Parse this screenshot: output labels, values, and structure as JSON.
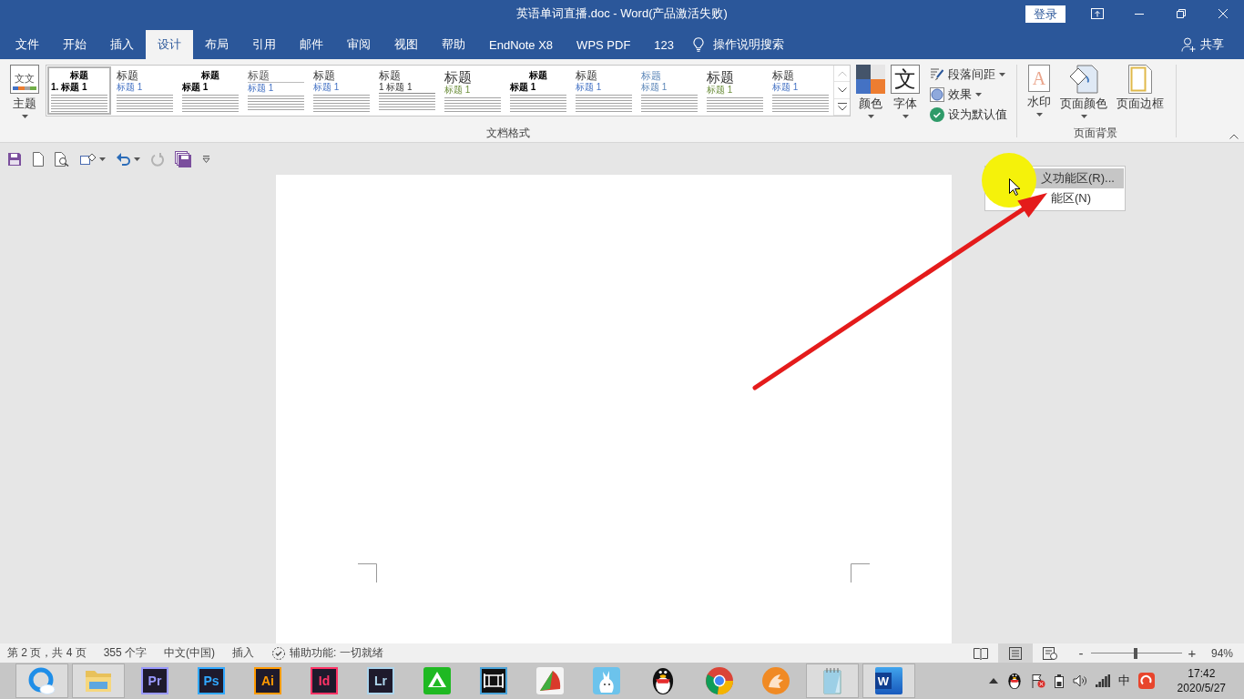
{
  "window": {
    "title": "英语单词直播.doc - Word(产品激活失败)",
    "sign_in": "登录"
  },
  "tabs": [
    {
      "label": "文件",
      "selected": false
    },
    {
      "label": "开始",
      "selected": false
    },
    {
      "label": "插入",
      "selected": false
    },
    {
      "label": "设计",
      "selected": true
    },
    {
      "label": "布局",
      "selected": false
    },
    {
      "label": "引用",
      "selected": false
    },
    {
      "label": "邮件",
      "selected": false
    },
    {
      "label": "审阅",
      "selected": false
    },
    {
      "label": "视图",
      "selected": false
    },
    {
      "label": "帮助",
      "selected": false
    },
    {
      "label": "EndNote X8",
      "selected": false
    },
    {
      "label": "WPS PDF",
      "selected": false
    },
    {
      "label": "123",
      "selected": false
    }
  ],
  "tell_me": {
    "label": "操作说明搜索"
  },
  "share": {
    "label": "共享"
  },
  "ribbon": {
    "document_formatting": {
      "label": "文档格式",
      "theme_button": {
        "label": "主题",
        "icon_text": "文文",
        "has_menu": true
      },
      "style_gallery": [
        {
          "kind": "centered",
          "heading": "标题",
          "subheading": "1. 标题 1",
          "selected": true
        },
        {
          "kind": "plain",
          "heading": "标题",
          "subheading": "标题 1",
          "selected": false
        },
        {
          "kind": "centered",
          "heading": "标题",
          "subheading": "标题 1",
          "selected": false
        },
        {
          "kind": "underlined",
          "heading": "标题",
          "subheading": "标题 1",
          "selected": false
        },
        {
          "kind": "plain",
          "heading": "标题",
          "subheading": "标题 1",
          "selected": false
        },
        {
          "kind": "ruled",
          "heading": "标题",
          "subheading": "1 标题 1",
          "selected": false
        },
        {
          "kind": "large",
          "heading": "标题",
          "subheading": "标题 1",
          "selected": false
        },
        {
          "kind": "centered",
          "heading": "标题",
          "subheading": "标题 1",
          "selected": false
        },
        {
          "kind": "plain",
          "heading": "标题",
          "subheading": "标题 1",
          "selected": false
        },
        {
          "kind": "accent",
          "heading": "标题",
          "subheading": "标题 1",
          "selected": false
        },
        {
          "kind": "large",
          "heading": "标题",
          "subheading": "标题 1",
          "selected": false
        },
        {
          "kind": "plain",
          "heading": "标题",
          "subheading": "标题 1",
          "selected": false
        }
      ],
      "gallery_scroll": [
        {
          "kind": "up",
          "disabled": true
        },
        {
          "kind": "down",
          "disabled": false
        },
        {
          "kind": "more",
          "disabled": false
        }
      ],
      "colors_button": {
        "label": "颜色",
        "has_menu": true
      },
      "fonts_button": {
        "label": "字体",
        "icon_text": "文",
        "has_menu": true
      },
      "small_buttons": [
        {
          "kind": "paragraph-spacing",
          "label": "段落间距",
          "has_menu": true
        },
        {
          "kind": "effects",
          "label": "效果",
          "has_menu": true
        },
        {
          "kind": "set-default",
          "label": "设为默认值",
          "has_menu": false
        }
      ]
    },
    "page_background": {
      "label": "页面背景",
      "buttons": [
        {
          "kind": "watermark",
          "label": "水印",
          "icon_text": "A",
          "has_menu": true
        },
        {
          "kind": "page-color",
          "label": "页面颜色",
          "has_menu": true
        },
        {
          "kind": "page-borders",
          "label": "页面边框",
          "has_menu": false
        }
      ]
    }
  },
  "quick_access": [
    {
      "kind": "save",
      "has_menu": false,
      "disabled": false
    },
    {
      "kind": "new",
      "has_menu": false,
      "disabled": false
    },
    {
      "kind": "print-preview",
      "has_menu": false,
      "disabled": false
    },
    {
      "kind": "shapes",
      "has_menu": true,
      "disabled": false
    },
    {
      "kind": "undo",
      "has_menu": true,
      "disabled": false
    },
    {
      "kind": "redo",
      "has_menu": false,
      "disabled": true
    },
    {
      "kind": "save-all",
      "has_menu": false,
      "disabled": false
    },
    {
      "kind": "customize",
      "has_menu": false,
      "disabled": false
    }
  ],
  "context_menu": {
    "items": [
      {
        "label": "义功能区(R)...",
        "selected": true
      },
      {
        "label": "能区(N)",
        "selected": false
      }
    ]
  },
  "status_bar": {
    "items": [
      {
        "kind": "text",
        "label": "第 2 页，共 4 页"
      },
      {
        "kind": "text",
        "label": "355 个字"
      },
      {
        "kind": "text",
        "label": "中文(中国)"
      },
      {
        "kind": "text",
        "label": "插入"
      },
      {
        "kind": "accessibility",
        "label": "辅助功能: 一切就绪"
      }
    ],
    "views": [
      {
        "kind": "read",
        "selected": false
      },
      {
        "kind": "print",
        "selected": true
      },
      {
        "kind": "web",
        "selected": false
      }
    ],
    "zoom": {
      "minus": "-",
      "plus": "+",
      "level": 0.49,
      "reading": "94%"
    }
  },
  "taskbar": {
    "apps": [
      {
        "kind": "browser",
        "active": true
      },
      {
        "kind": "folder",
        "active": true
      },
      {
        "kind": "tile",
        "label": "Pr",
        "color": "#9999ff",
        "active": false
      },
      {
        "kind": "tile",
        "label": "Ps",
        "color": "#31a8ff",
        "active": false
      },
      {
        "kind": "tile",
        "label": "Ai",
        "color": "#ff9a00",
        "active": false
      },
      {
        "kind": "tile",
        "label": "Id",
        "color": "#ff3366",
        "active": false
      },
      {
        "kind": "tile",
        "label": "Lr",
        "color": "#add5ec",
        "active": false
      },
      {
        "kind": "green-app",
        "active": false
      },
      {
        "kind": "film",
        "active": false
      },
      {
        "kind": "red-green-app",
        "active": false
      },
      {
        "kind": "bunny",
        "active": false
      },
      {
        "kind": "penguin",
        "active": false
      },
      {
        "kind": "chrome",
        "active": false
      },
      {
        "kind": "fox",
        "active": false
      },
      {
        "kind": "notepad",
        "active": true
      },
      {
        "kind": "word",
        "label": "W",
        "active": true
      }
    ],
    "tray": [
      {
        "kind": "chevron"
      },
      {
        "kind": "penguin"
      },
      {
        "kind": "flag-error"
      },
      {
        "kind": "battery"
      },
      {
        "kind": "speaker"
      },
      {
        "kind": "signal"
      },
      {
        "kind": "ime",
        "label": "中"
      },
      {
        "kind": "sogou"
      }
    ],
    "time": "17:42",
    "date": "2020/5/27"
  }
}
